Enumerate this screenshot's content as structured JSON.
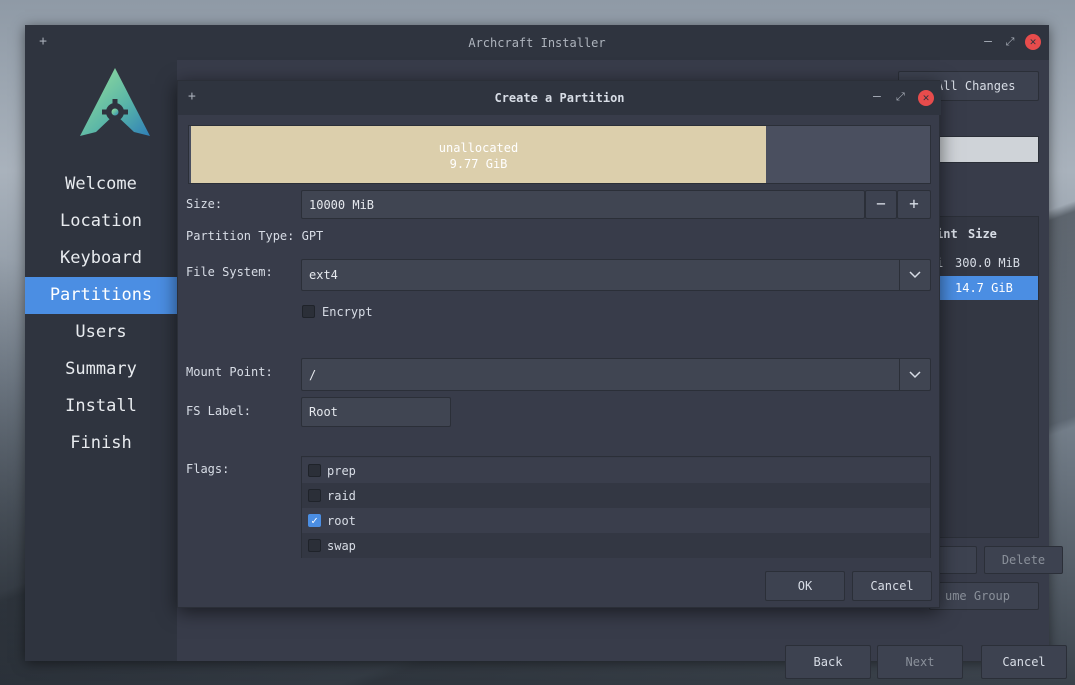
{
  "window": {
    "title": "Archcraft Installer",
    "add_icon": "+",
    "min_icon": "–",
    "max_icon": "⤢",
    "close_icon": "✕"
  },
  "sidebar": {
    "items": [
      {
        "label": "Welcome"
      },
      {
        "label": "Location"
      },
      {
        "label": "Keyboard"
      },
      {
        "label": "Partitions"
      },
      {
        "label": "Users"
      },
      {
        "label": "Summary"
      },
      {
        "label": "Install"
      },
      {
        "label": "Finish"
      }
    ],
    "active_index": 3
  },
  "background": {
    "revert_label": "t All Changes",
    "table_header_mount": "int",
    "table_header_size": "Size",
    "row1_mount": "i",
    "row1_size": "300.0 MiB",
    "row2_size": "14.7 GiB",
    "delete_label": "Delete",
    "volume_group_label": "ume Group",
    "back_label": "Back",
    "next_label": "Next",
    "cancel_label": "Cancel"
  },
  "dialog": {
    "title": "Create a Partition",
    "bar": {
      "name": "unallocated",
      "size": "9.77 GiB",
      "fraction_used": 0.78
    },
    "size_label": "Size:",
    "size_value": "10000 MiB",
    "minus": "−",
    "plus": "+",
    "ptype_label": "Partition Type: GPT",
    "fs_label": "File System:",
    "fs_value": "ext4",
    "encrypt_label": "Encrypt",
    "mount_label": "Mount Point:",
    "mount_value": "/",
    "fslabel_label": "FS Label:",
    "fslabel_value": "Root",
    "flags_label": "Flags:",
    "flags": [
      {
        "name": "prep",
        "checked": false
      },
      {
        "name": "raid",
        "checked": false
      },
      {
        "name": "root",
        "checked": true
      },
      {
        "name": "swap",
        "checked": false
      }
    ],
    "ok_label": "OK",
    "cancel_label": "Cancel"
  },
  "colors": {
    "accent": "#4b8ee3",
    "unallocated": "#dccfac",
    "close": "#e74c4c"
  }
}
